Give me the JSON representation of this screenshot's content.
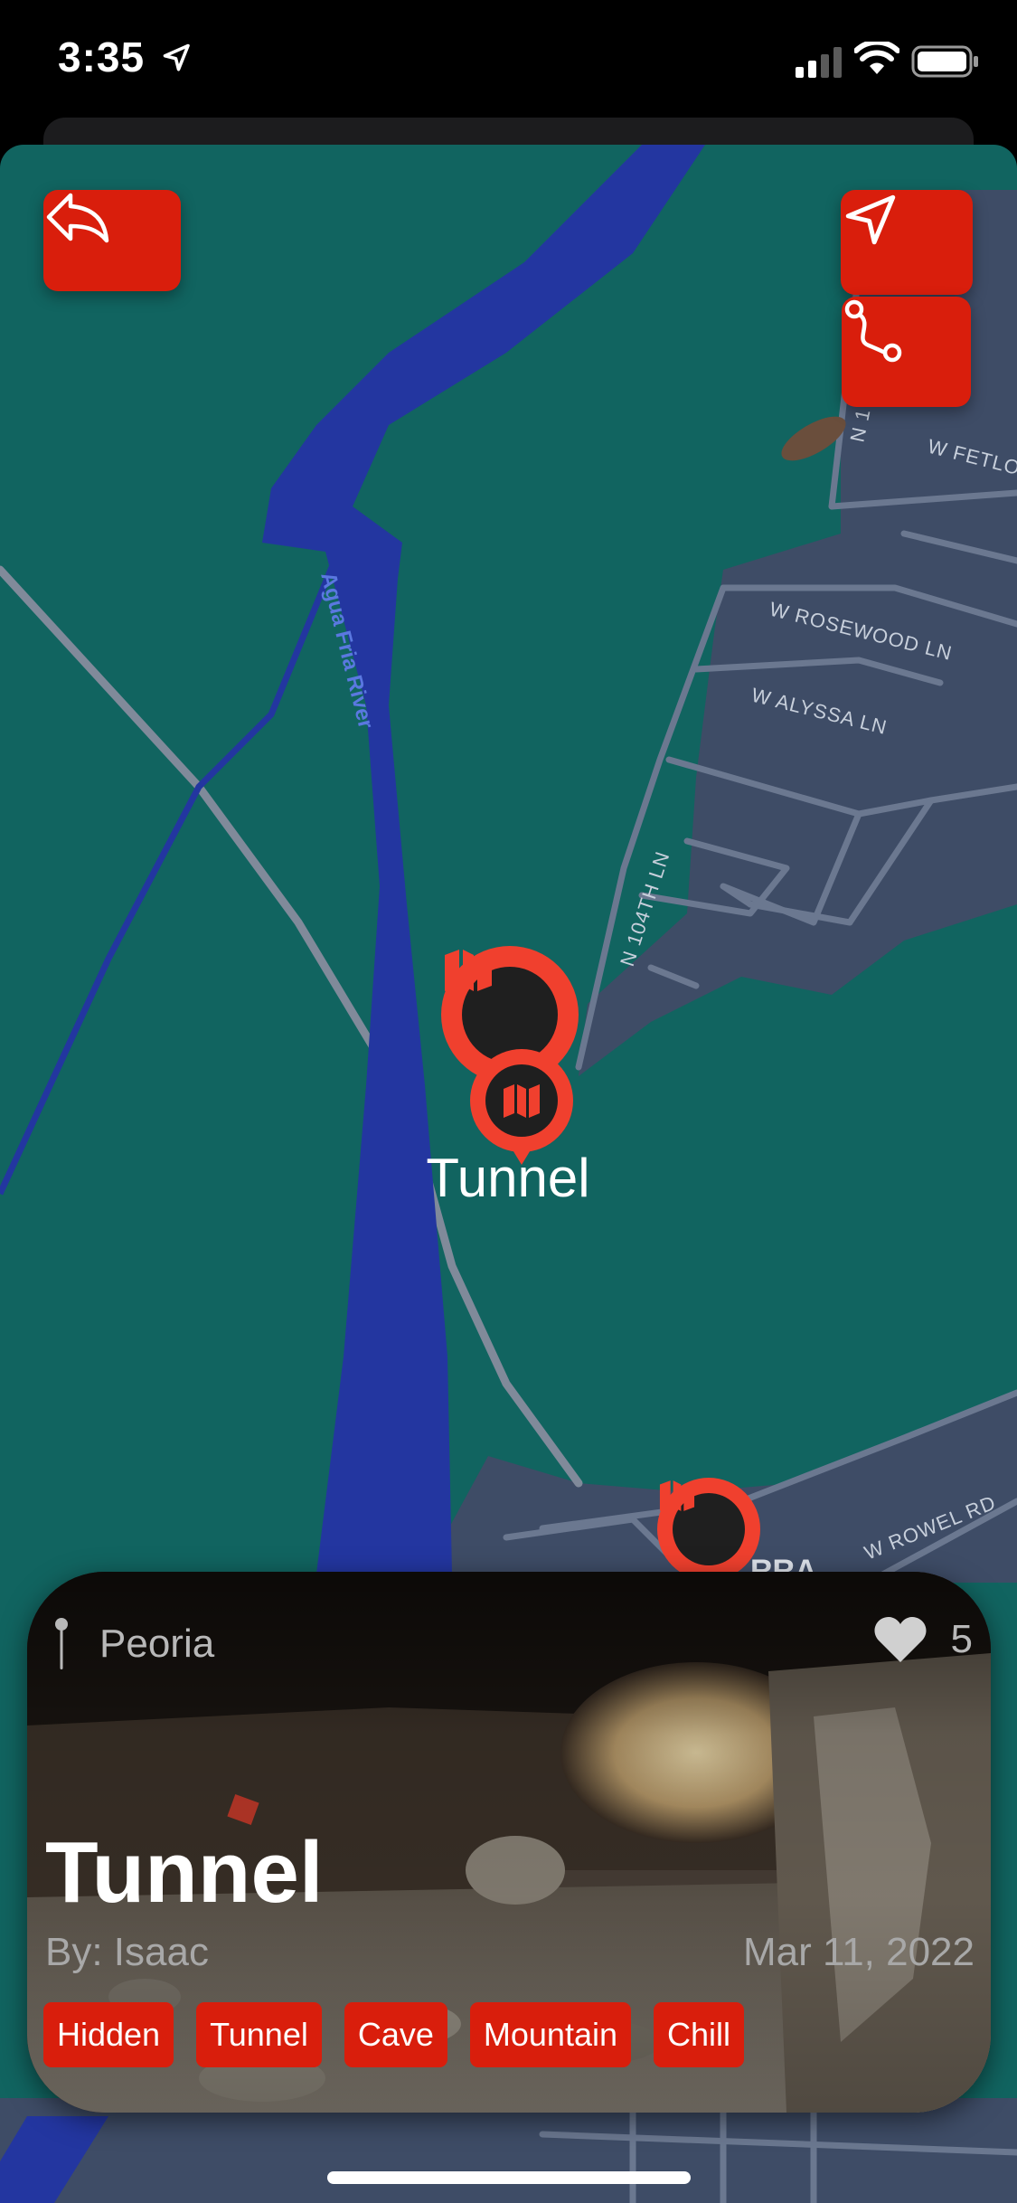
{
  "status_bar": {
    "time": "3:35"
  },
  "map": {
    "labels": {
      "river": "Agua Fria River",
      "road_rosewood": "W ROSEWOOD LN",
      "road_alyssa": "W ALYSSA LN",
      "road_104th": "N 104TH LN",
      "road_fetlock": "W FETLO",
      "road_rowel": "W ROWEL RD",
      "road_n1": "N 1",
      "area_partial": "RRA"
    },
    "pin_label": "Tunnel"
  },
  "spot_card": {
    "city": "Peoria",
    "likes": "5",
    "title": "Tunnel",
    "author": "By: Isaac",
    "date": "Mar 11, 2022",
    "tags": [
      "Hidden",
      "Tunnel",
      "Cave",
      "Mountain",
      "Chill"
    ]
  },
  "colors": {
    "accent": "#d91e0c",
    "pin": "#f0402e",
    "map_land": "#116460",
    "map_water": "#2336a0",
    "map_urban": "#3e4c66"
  },
  "icons": {
    "back": "reply-arrow-icon",
    "locate": "location-arrow-icon",
    "route": "route-icon",
    "pin": "map-icon",
    "city": "pin-icon",
    "likes": "heart-icon"
  }
}
